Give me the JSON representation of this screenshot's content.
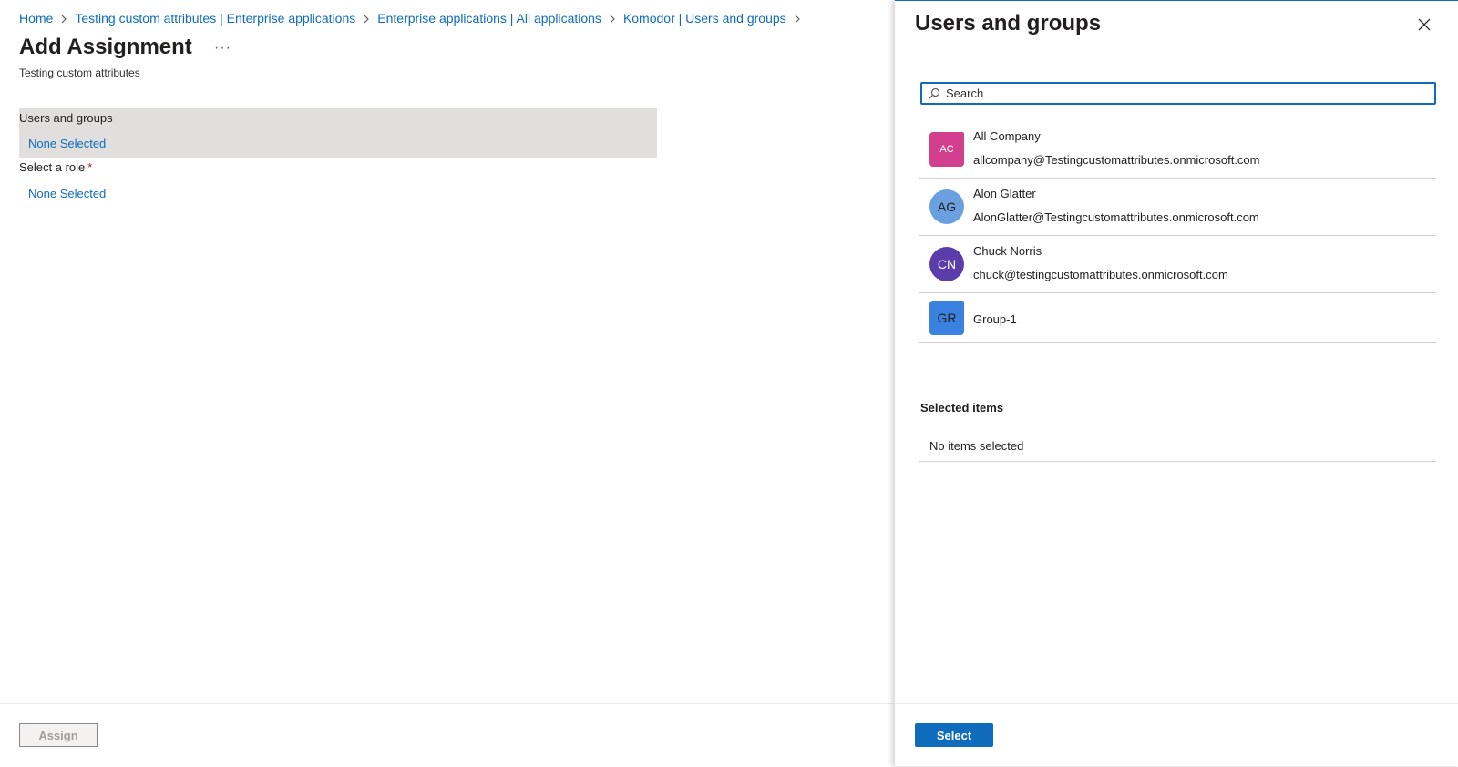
{
  "breadcrumb": [
    {
      "label": "Home"
    },
    {
      "label": "Testing custom attributes | Enterprise applications"
    },
    {
      "label": "Enterprise applications | All applications"
    },
    {
      "label": "Komodor | Users and groups"
    }
  ],
  "page": {
    "title": "Add Assignment",
    "more_label": "···",
    "subtitle": "Testing custom attributes"
  },
  "form": {
    "users_groups_label": "Users and groups",
    "users_groups_value": "None Selected",
    "role_label": "Select a role",
    "role_required": "*",
    "role_value": "None Selected"
  },
  "footer": {
    "assign_label": "Assign",
    "select_label": "Select"
  },
  "panel": {
    "title": "Users and groups",
    "search_placeholder": "Search",
    "results": [
      {
        "initials": "AC",
        "name": "All Company",
        "email": "allcompany@Testingcustomattributes.onmicrosoft.com",
        "color": "#d13f8e",
        "shape": "square"
      },
      {
        "initials": "AG",
        "name": "Alon Glatter",
        "email": "AlonGlatter@Testingcustomattributes.onmicrosoft.com",
        "color": "#6a9fe0",
        "shape": "circle"
      },
      {
        "initials": "CN",
        "name": "Chuck Norris",
        "email": "chuck@testingcustomattributes.onmicrosoft.com",
        "color": "#5a3dab",
        "shape": "circle"
      },
      {
        "initials": "GR",
        "name": "Group-1",
        "email": "",
        "color": "#3b82e0",
        "shape": "square"
      }
    ],
    "selected_header": "Selected items",
    "selected_empty": "No items selected"
  },
  "colors": {
    "accent": "#0f6cbd",
    "field_highlight": "#e1dfdd"
  }
}
